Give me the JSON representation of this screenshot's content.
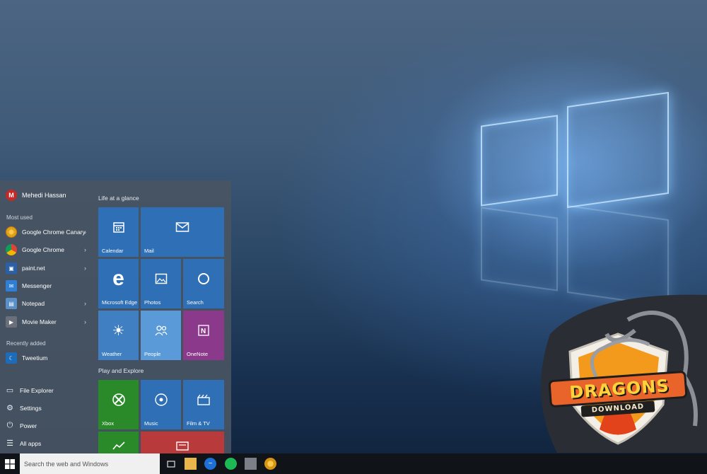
{
  "start_menu": {
    "user": {
      "name": "Mehedi Hassan",
      "initial": "M"
    },
    "most_used_label": "Most used",
    "most_used": [
      {
        "label": "Google Chrome Canary",
        "icon": "chrome-canary-icon",
        "has_submenu": true
      },
      {
        "label": "Google Chrome",
        "icon": "chrome-icon",
        "has_submenu": true
      },
      {
        "label": "paint.net",
        "icon": "paintnet-icon",
        "has_submenu": true
      },
      {
        "label": "Messenger",
        "icon": "messenger-icon",
        "has_submenu": false
      },
      {
        "label": "Notepad",
        "icon": "notepad-icon",
        "has_submenu": true
      },
      {
        "label": "Movie Maker",
        "icon": "movie-maker-icon",
        "has_submenu": true
      }
    ],
    "recently_added_label": "Recently added",
    "recently_added": [
      {
        "label": "Tweetium",
        "icon": "tweetium-icon"
      }
    ],
    "system": [
      {
        "label": "File Explorer",
        "icon": "folder-icon"
      },
      {
        "label": "Settings",
        "icon": "gear-icon"
      },
      {
        "label": "Power",
        "icon": "power-icon"
      },
      {
        "label": "All apps",
        "icon": "all-apps-icon"
      }
    ],
    "groups": [
      {
        "title": "Life at a glance"
      },
      {
        "title": "Play and Explore"
      }
    ],
    "tiles": {
      "calendar": "Calendar",
      "mail": "Mail",
      "edge": "Microsoft Edge",
      "photos": "Photos",
      "search": "Search",
      "weather": "Weather",
      "people": "People",
      "onenote": "OneNote",
      "xbox": "Xbox",
      "music": "Music",
      "film": "Film & TV"
    }
  },
  "taskbar": {
    "search_placeholder": "Search the web and Windows",
    "apps": [
      "task-view-icon",
      "file-explorer-icon",
      "messenger-icon",
      "spotify-icon",
      "movie-maker-icon",
      "chrome-canary-icon"
    ]
  },
  "watermark": {
    "line1": "DRAGONS",
    "line2": "DOWNLOAD"
  },
  "colors": {
    "tile_blue": "#2e6fb5",
    "tile_light_blue": "#5a9ad8",
    "tile_onenote": "#8b3a8b",
    "tile_xbox": "#2a8a2a",
    "tile_red": "#b93a3a",
    "badge_orange": "#f39a1c"
  }
}
